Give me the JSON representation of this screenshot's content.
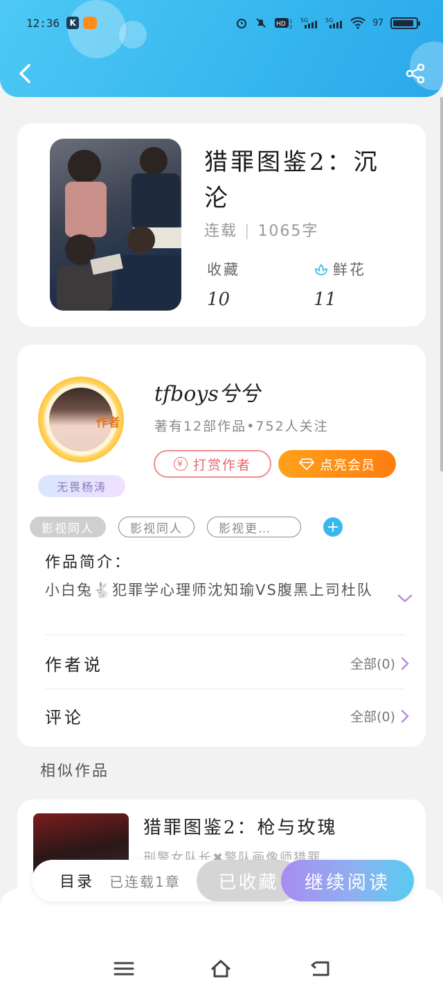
{
  "status_bar": {
    "time": "12:36",
    "app_k": "K",
    "battery_pct": "97"
  },
  "header": {
    "back": "back-arrow-icon",
    "share": "share-icon"
  },
  "book": {
    "title": "猎罪图鉴2：沉沦",
    "status": "连载",
    "word_count": "1065字",
    "favorites_label": "收藏",
    "favorites_value": "10",
    "flowers_label": "鲜花",
    "flowers_value": "11"
  },
  "author": {
    "name": "tfboys兮兮",
    "meta": "著有12部作品•752人关注",
    "badge": "作者",
    "tag": "无畏杨涛",
    "reward_label": "打赏作者",
    "vip_label": "点亮会员"
  },
  "tags": [
    "影视同人",
    "影视同人",
    "影视更…"
  ],
  "intro": {
    "label": "作品简介：",
    "text": "小白兔🐇犯罪学心理师沈知瑜VS腹黑上司杜队"
  },
  "author_says": {
    "label": "作者说",
    "count": "全部(0)"
  },
  "comments": {
    "label": "评论",
    "count": "全部(0)"
  },
  "similar": {
    "section_title": "相似作品",
    "title": "猎罪图鉴2：枪与玫瑰",
    "desc": "刑警女队长✖警队画像师猎罪…"
  },
  "action_bar": {
    "toc": "目录",
    "chapters": "已连载1章",
    "collected": "已收藏",
    "continue": "继续阅读"
  },
  "colors": {
    "header": "#35b6ee",
    "vip": "#ff8c14",
    "accent": "#39b8ef",
    "reward": "#e86a6a"
  }
}
